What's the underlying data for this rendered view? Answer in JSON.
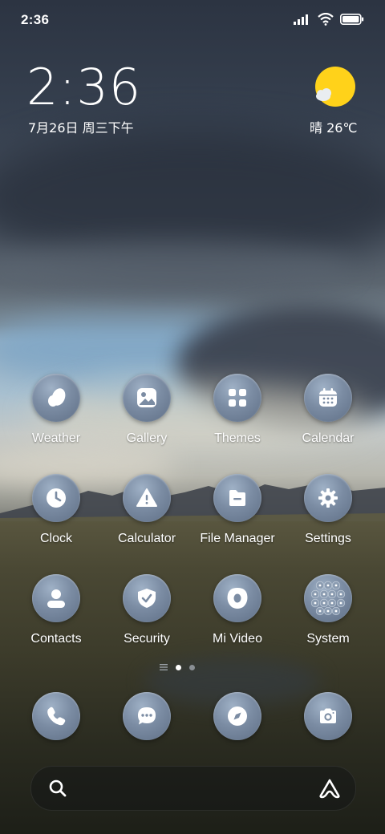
{
  "status_bar": {
    "time": "2:36"
  },
  "clock_widget": {
    "time": "2:36",
    "date": "7月26日 周三下午"
  },
  "weather_widget": {
    "text": "晴 26℃",
    "icon": "sun-with-cloud-icon"
  },
  "apps": [
    {
      "label": "Weather",
      "icon": "weather-icon"
    },
    {
      "label": "Gallery",
      "icon": "gallery-icon"
    },
    {
      "label": "Themes",
      "icon": "themes-icon"
    },
    {
      "label": "Calendar",
      "icon": "calendar-icon"
    },
    {
      "label": "Clock",
      "icon": "clock-icon"
    },
    {
      "label": "Calculator",
      "icon": "calculator-icon"
    },
    {
      "label": "File Manager",
      "icon": "folder-icon"
    },
    {
      "label": "Settings",
      "icon": "gear-icon"
    },
    {
      "label": "Contacts",
      "icon": "contacts-icon"
    },
    {
      "label": "Security",
      "icon": "shield-icon"
    },
    {
      "label": "Mi Video",
      "icon": "video-icon"
    },
    {
      "label": "System",
      "icon": "folder-grid-icon"
    }
  ],
  "page_indicator": {
    "pages": 2,
    "current": 1
  },
  "dock": [
    {
      "icon": "phone-icon"
    },
    {
      "icon": "message-icon"
    },
    {
      "icon": "compass-icon"
    },
    {
      "icon": "camera-icon"
    }
  ],
  "search_bar": {
    "left_icon": "search-icon",
    "right_icon": "assistant-icon"
  },
  "colors": {
    "icon_bg": "#7b8ca3",
    "sun": "#ffd21a"
  }
}
